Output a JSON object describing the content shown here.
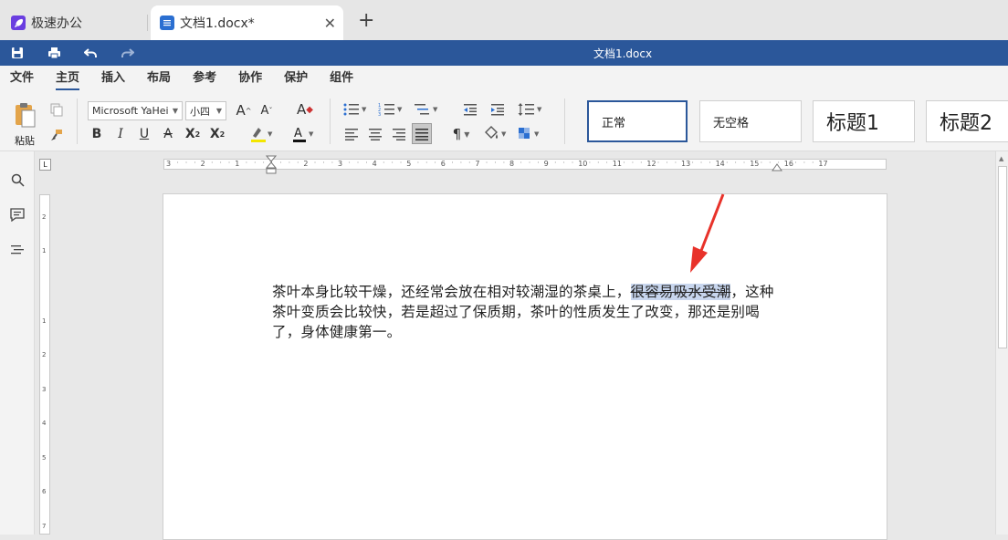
{
  "tabs": {
    "home_label": "极速办公",
    "doc_label": "文档1.docx*",
    "close_glyph": "✕",
    "new_tab_glyph": "+"
  },
  "titlebar": {
    "doc_title": "文档1.docx",
    "accent_color": "#2b579a"
  },
  "menu": {
    "items": [
      "文件",
      "主页",
      "插入",
      "布局",
      "参考",
      "协作",
      "保护",
      "组件"
    ],
    "active": "主页"
  },
  "ribbon": {
    "paste_label": "粘贴",
    "font_name": "Microsoft YaHei",
    "font_size": "小四",
    "styles": [
      "正常",
      "无空格",
      "标题1",
      "标题2"
    ],
    "selected_style": "正常"
  },
  "ruler": {
    "h_numbers": [
      "3",
      "2",
      "1",
      "1",
      "2",
      "3",
      "4",
      "5",
      "6",
      "7",
      "8",
      "9",
      "10",
      "11",
      "12",
      "13",
      "14",
      "15",
      "16",
      "17"
    ],
    "v_numbers": [
      "2",
      "1",
      "1",
      "2",
      "3",
      "4",
      "5",
      "6",
      "7"
    ]
  },
  "document": {
    "before": "茶叶本身比较干燥，还经常会放在相对较潮湿的茶桌上，",
    "highlighted": "很容易吸水受潮",
    "after": "，这种茶叶变质会比较快，若是超过了保质期，茶叶的性质发生了改变，那还是别喝了，身体健康第一。"
  },
  "icons": {
    "home_tab": "rocket-icon",
    "doc_tab": "document-icon",
    "save": "save-icon",
    "print": "print-icon",
    "undo": "undo-icon",
    "redo": "redo-icon",
    "search": "search-icon",
    "comment": "comment-icon",
    "navigation": "navigation-icon",
    "annotation": "red-arrow-annotation"
  }
}
